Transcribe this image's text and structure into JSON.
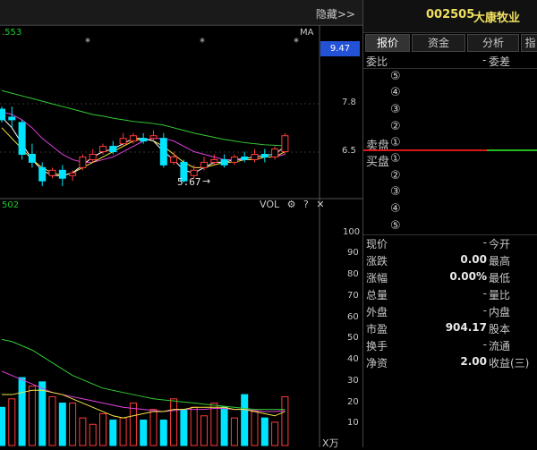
{
  "toolbar": {
    "hide_label": "隐藏>>"
  },
  "chart": {
    "indicator_value": ".553",
    "ma_label": "MA",
    "current_price_badge": "9.47",
    "price_axis": [
      "7.8",
      "6.5"
    ],
    "min_price_annotation": "5.67",
    "vol_label": "VOL",
    "vol_indicator_value": "502",
    "vol_axis": [
      "100",
      "90",
      "80",
      "70",
      "60",
      "50",
      "40",
      "30",
      "20",
      "10"
    ],
    "vol_unit": "X万",
    "colors": {
      "up": "#ff3b3b",
      "down": "#00e5ff",
      "ma_yellow": "#f5e642",
      "ma_magenta": "#e040e0",
      "ma_green": "#33cc33",
      "ma_white": "#ffffff"
    }
  },
  "chart_data": [
    {
      "type": "candlestick",
      "title": "",
      "ma_label": "MA",
      "y_ticks": [
        7.8,
        6.5
      ],
      "min_annotation": 5.67,
      "latest_marker": 9.47,
      "candles": [
        {
          "o": 7.05,
          "c": 6.85,
          "h": 7.1,
          "l": 6.8
        },
        {
          "o": 6.9,
          "c": 6.85,
          "h": 7.1,
          "l": 6.7
        },
        {
          "o": 6.8,
          "c": 6.2,
          "h": 6.85,
          "l": 6.1
        },
        {
          "o": 6.2,
          "c": 6.05,
          "h": 6.4,
          "l": 5.95
        },
        {
          "o": 5.95,
          "c": 5.7,
          "h": 6.05,
          "l": 5.6
        },
        {
          "o": 5.8,
          "c": 5.9,
          "h": 5.95,
          "l": 5.75
        },
        {
          "o": 5.9,
          "c": 5.75,
          "h": 6.0,
          "l": 5.6
        },
        {
          "o": 5.8,
          "c": 5.85,
          "h": 5.9,
          "l": 5.7
        },
        {
          "o": 5.95,
          "c": 6.15,
          "h": 6.2,
          "l": 5.9
        },
        {
          "o": 6.1,
          "c": 6.2,
          "h": 6.3,
          "l": 6.05
        },
        {
          "o": 6.25,
          "c": 6.35,
          "h": 6.4,
          "l": 6.2
        },
        {
          "o": 6.35,
          "c": 6.25,
          "h": 6.45,
          "l": 6.2
        },
        {
          "o": 6.4,
          "c": 6.5,
          "h": 6.6,
          "l": 6.35
        },
        {
          "o": 6.45,
          "c": 6.55,
          "h": 6.6,
          "l": 6.4
        },
        {
          "o": 6.5,
          "c": 6.45,
          "h": 6.6,
          "l": 6.4
        },
        {
          "o": 6.5,
          "c": 6.55,
          "h": 6.65,
          "l": 6.45
        },
        {
          "o": 6.5,
          "c": 6.0,
          "h": 6.6,
          "l": 5.95
        },
        {
          "o": 6.05,
          "c": 6.15,
          "h": 6.25,
          "l": 6.0
        },
        {
          "o": 6.05,
          "c": 5.7,
          "h": 6.1,
          "l": 5.67
        },
        {
          "o": 5.8,
          "c": 5.9,
          "h": 6.0,
          "l": 5.75
        },
        {
          "o": 5.95,
          "c": 6.05,
          "h": 6.15,
          "l": 5.9
        },
        {
          "o": 6.05,
          "c": 6.1,
          "h": 6.2,
          "l": 6.0
        },
        {
          "o": 6.1,
          "c": 6.0,
          "h": 6.2,
          "l": 5.95
        },
        {
          "o": 6.05,
          "c": 6.15,
          "h": 6.2,
          "l": 6.0
        },
        {
          "o": 6.15,
          "c": 6.1,
          "h": 6.25,
          "l": 6.05
        },
        {
          "o": 6.1,
          "c": 6.2,
          "h": 6.3,
          "l": 6.05
        },
        {
          "o": 6.2,
          "c": 6.15,
          "h": 6.3,
          "l": 6.05
        },
        {
          "o": 6.15,
          "c": 6.3,
          "h": 6.35,
          "l": 6.1
        },
        {
          "o": 6.25,
          "c": 6.55,
          "h": 6.6,
          "l": 6.2
        }
      ],
      "ma_series": [
        {
          "color": "#33cc33",
          "values": [
            7.4,
            7.35,
            7.3,
            7.25,
            7.2,
            7.15,
            7.1,
            7.05,
            7.0,
            6.95,
            6.92,
            6.88,
            6.85,
            6.82,
            6.8,
            6.78,
            6.75,
            6.7,
            6.65,
            6.6,
            6.56,
            6.52,
            6.48,
            6.45,
            6.42,
            6.4,
            6.38,
            6.37,
            6.36
          ]
        },
        {
          "color": "#e040e0",
          "values": [
            7.0,
            6.95,
            6.85,
            6.7,
            6.5,
            6.35,
            6.2,
            6.1,
            6.05,
            6.05,
            6.1,
            6.15,
            6.25,
            6.35,
            6.45,
            6.5,
            6.5,
            6.45,
            6.35,
            6.25,
            6.2,
            6.15,
            6.1,
            6.1,
            6.1,
            6.1,
            6.15,
            6.15,
            6.2
          ]
        },
        {
          "color": "#f5e642",
          "values": [
            6.7,
            6.5,
            6.3,
            6.1,
            5.95,
            5.85,
            5.8,
            5.85,
            5.95,
            6.05,
            6.15,
            6.25,
            6.35,
            6.45,
            6.5,
            6.45,
            6.35,
            6.2,
            6.05,
            5.95,
            5.95,
            6.0,
            6.05,
            6.05,
            6.1,
            6.1,
            6.15,
            6.15,
            6.25
          ]
        },
        {
          "color": "#ffffff",
          "values": [
            6.9,
            6.7,
            6.4,
            6.1,
            5.9,
            5.8,
            5.8,
            5.85,
            6.0,
            6.15,
            6.25,
            6.3,
            6.4,
            6.5,
            6.5,
            6.45,
            6.25,
            6.1,
            5.9,
            5.85,
            5.95,
            6.05,
            6.05,
            6.1,
            6.12,
            6.15,
            6.18,
            6.2,
            6.35
          ]
        }
      ]
    },
    {
      "type": "bar",
      "title": "VOL",
      "unit": "X万",
      "ylim": [
        0,
        110
      ],
      "y_ticks": [
        100,
        90,
        80,
        70,
        60,
        50,
        40,
        30,
        20,
        10
      ],
      "values": [
        18,
        22,
        32,
        28,
        30,
        23,
        20,
        20,
        13,
        10,
        15,
        12,
        13,
        20,
        12,
        17,
        12,
        22,
        17,
        18,
        14,
        20,
        18,
        13,
        24,
        16,
        13,
        11,
        23
      ],
      "up": [
        false,
        true,
        false,
        true,
        false,
        true,
        false,
        true,
        true,
        true,
        true,
        false,
        true,
        true,
        false,
        true,
        false,
        true,
        false,
        true,
        true,
        true,
        false,
        true,
        false,
        true,
        false,
        true,
        true
      ],
      "ma_series": [
        {
          "color": "#33cc33",
          "values": [
            50,
            49,
            47,
            45,
            42,
            39,
            36,
            33,
            31,
            29,
            27,
            26,
            25,
            24,
            23,
            22,
            21.5,
            21,
            20.5,
            20,
            19.5,
            19,
            18.5,
            18,
            17.5,
            17,
            17,
            17,
            17
          ]
        },
        {
          "color": "#e040e0",
          "values": [
            35,
            33,
            31,
            29,
            27,
            25,
            24,
            23,
            22,
            21,
            20,
            19,
            18,
            17.5,
            17,
            16.5,
            16,
            16.5,
            17,
            17,
            17,
            17.5,
            17.5,
            17,
            17,
            16.5,
            16,
            16,
            16.5
          ]
        },
        {
          "color": "#f5e642",
          "values": [
            24,
            24,
            25,
            26,
            26,
            25,
            24,
            22,
            20,
            18,
            16,
            14,
            13,
            14,
            15,
            16,
            16,
            17,
            17,
            18,
            18,
            18,
            18,
            17,
            17,
            16,
            15,
            14,
            16
          ]
        }
      ]
    }
  ],
  "right_panel": {
    "stock_code": "002505",
    "stock_name": "大康牧业",
    "tabs": [
      {
        "label": "报价"
      },
      {
        "label": "资金"
      },
      {
        "label": "分析"
      },
      {
        "label": "指"
      }
    ],
    "order_ratio_label": "委比",
    "order_diff_label": "委差",
    "order_ratio_value": "-",
    "sell_label": "卖盘",
    "buy_label": "买盘",
    "sell_levels": [
      "⑤",
      "④",
      "③",
      "②",
      "①"
    ],
    "buy_levels": [
      "①",
      "②",
      "③",
      "④",
      "⑤"
    ],
    "quotes": [
      {
        "label": "现价",
        "value": "-",
        "label2": "今开"
      },
      {
        "label": "涨跌",
        "value": "0.00",
        "label2": "最高"
      },
      {
        "label": "涨幅",
        "value": "0.00%",
        "label2": "最低"
      },
      {
        "label": "总量",
        "value": "-",
        "label2": "量比"
      },
      {
        "label": "外盘",
        "value": "-",
        "label2": "内盘"
      },
      {
        "label": "市盈",
        "value": "904.17",
        "label2": "股本"
      },
      {
        "label": "换手",
        "value": "-",
        "label2": "流通"
      },
      {
        "label": "净资",
        "value": "2.00",
        "label2": "收益(三)"
      }
    ]
  }
}
